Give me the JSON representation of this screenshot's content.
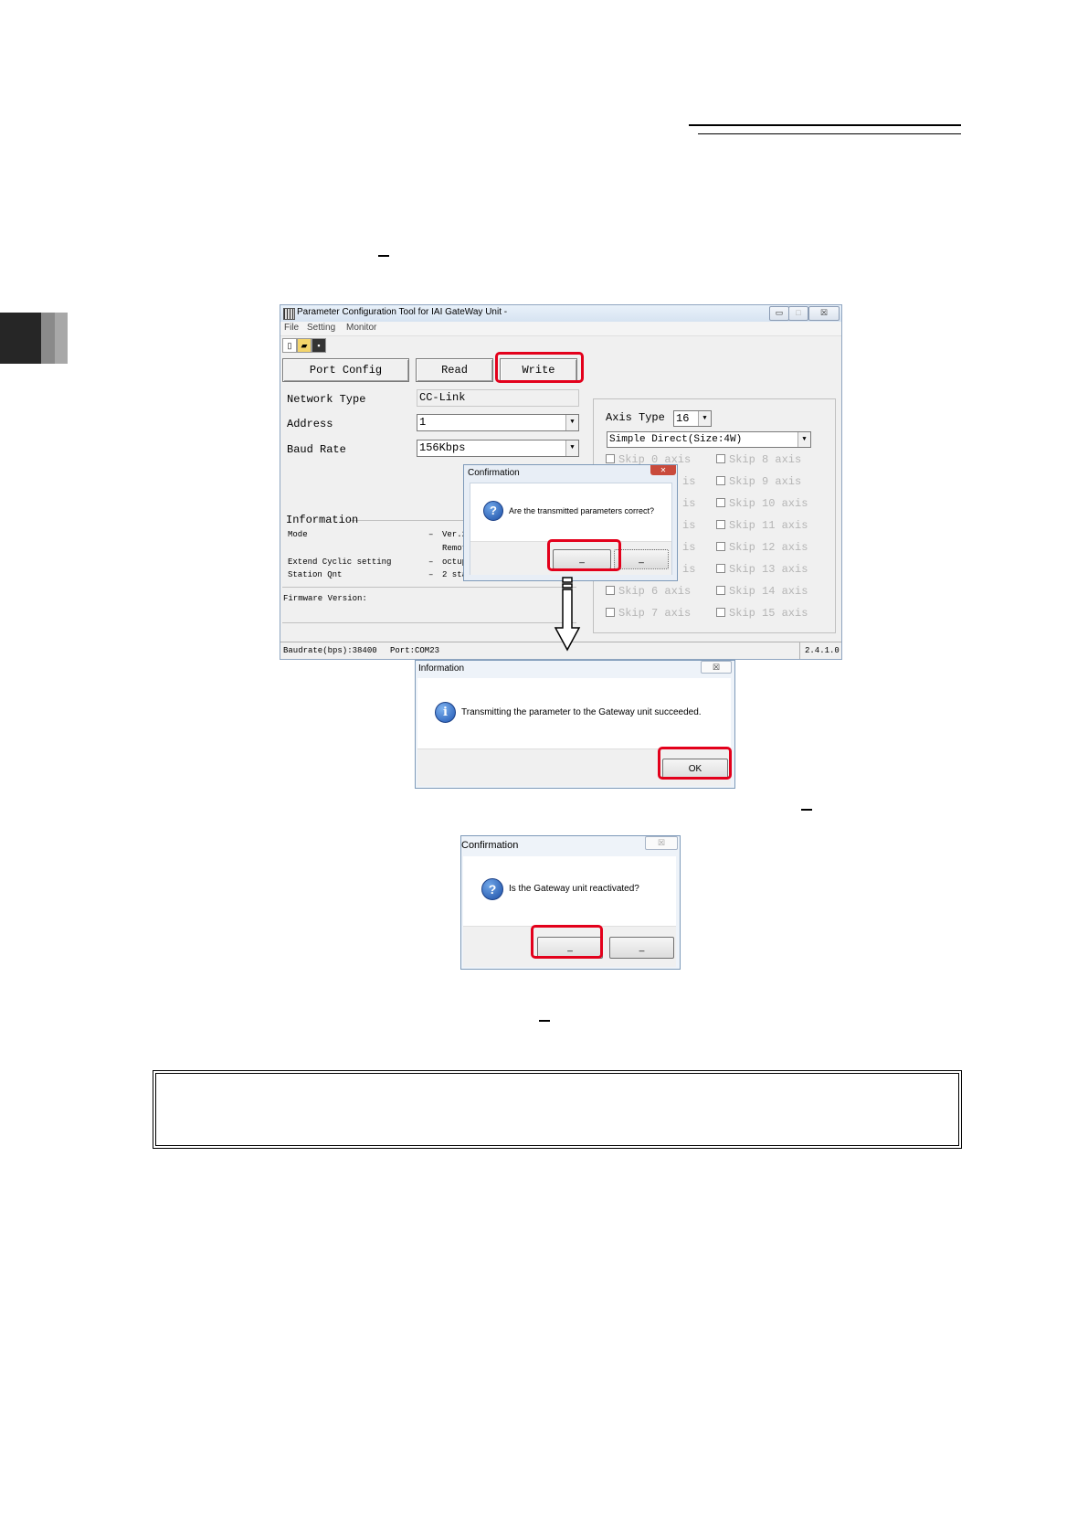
{
  "main_window": {
    "title": "Parameter Configuration Tool for IAI GateWay Unit -",
    "window_buttons": [
      "▭",
      "□",
      "☒"
    ],
    "menu": [
      "File",
      "Setting",
      "Monitor"
    ],
    "toolbar_icons": [
      "new-file-icon",
      "open-folder-icon",
      "save-disk-icon"
    ],
    "buttons": {
      "port_config": "Port Config",
      "read": "Read",
      "write": "Write"
    },
    "fields": {
      "network_type_label": "Network Type",
      "network_type_value": "CC-Link",
      "address_label": "Address",
      "address_value": "1",
      "baud_rate_label": "Baud Rate",
      "baud_rate_value": "156Kbps"
    },
    "axis": {
      "label": "Axis Type",
      "count": "16",
      "mode": "Simple Direct(Size:4W)",
      "skips_left": [
        "Skip 0 axis",
        "is",
        "is",
        "is",
        "is",
        "is",
        "Skip 6 axis",
        "Skip 7 axis"
      ],
      "skips_right": [
        "Skip 8 axis",
        "Skip 9 axis",
        "Skip 10 axis",
        "Skip 11 axis",
        "Skip 12 axis",
        "Skip 13 axis",
        "Skip 14 axis",
        "Skip 15 axis"
      ]
    },
    "information": {
      "heading": "Information",
      "rows": [
        {
          "label": "Mode",
          "dash": "–",
          "value": "Ver.2"
        },
        {
          "label": "",
          "dash": "",
          "value": "Remot"
        },
        {
          "label": "Extend Cyclic setting",
          "dash": "–",
          "value": "octup"
        },
        {
          "label": "Station Qnt",
          "dash": "–",
          "value": "2 sta"
        }
      ]
    },
    "firmware_label": "Firmware Version:",
    "status": {
      "baudrate": "Baudrate(bps):38400",
      "port": "Port:COM23",
      "version": "2.4.1.0"
    }
  },
  "confirm_dialog_1": {
    "title": "Confirmation",
    "close": "✕",
    "message": "Are the transmitted parameters correct?",
    "btn_yes": "_",
    "btn_no": "_"
  },
  "info_dialog": {
    "title": "Information",
    "close": "☒",
    "message": "Transmitting the parameter to the Gateway unit succeeded.",
    "ok": "OK"
  },
  "confirm_dialog_2": {
    "title": "Confirmation",
    "close": "☒",
    "message": "Is the Gateway unit reactivated?",
    "btn_yes": "_",
    "btn_no": "_"
  },
  "icons": {
    "question": "?",
    "info": "i"
  },
  "colors": {
    "highlight": "#e3001b"
  }
}
